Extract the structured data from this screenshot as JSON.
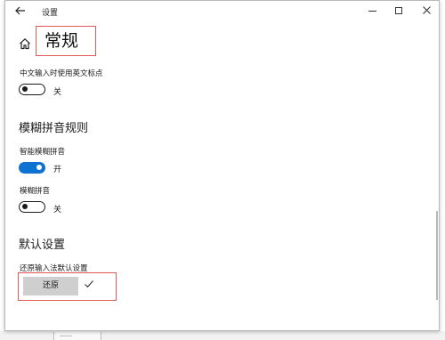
{
  "titlebar": {
    "title": "设置",
    "back_icon": "arrow-left-icon",
    "minimize_icon": "minimize-icon",
    "maximize_icon": "maximize-icon",
    "close_icon": "close-icon"
  },
  "header": {
    "home_icon": "home-icon",
    "title": "常规"
  },
  "settings": {
    "english_punct": {
      "label": "中文输入时使用英文标点",
      "state": "关",
      "on": false
    },
    "fuzzy_section_heading": "模糊拼音规则",
    "smart_fuzzy": {
      "label": "智能模糊拼音",
      "state": "开",
      "on": true
    },
    "fuzzy": {
      "label": "模糊拼音",
      "state": "关",
      "on": false
    },
    "default_section_heading": "默认设置",
    "restore": {
      "label": "还原输入法默认设置",
      "button_label": "还原",
      "done_icon": "checkmark-icon"
    }
  },
  "colors": {
    "accent": "#0e72d2",
    "highlight_border": "#e05a5a"
  }
}
